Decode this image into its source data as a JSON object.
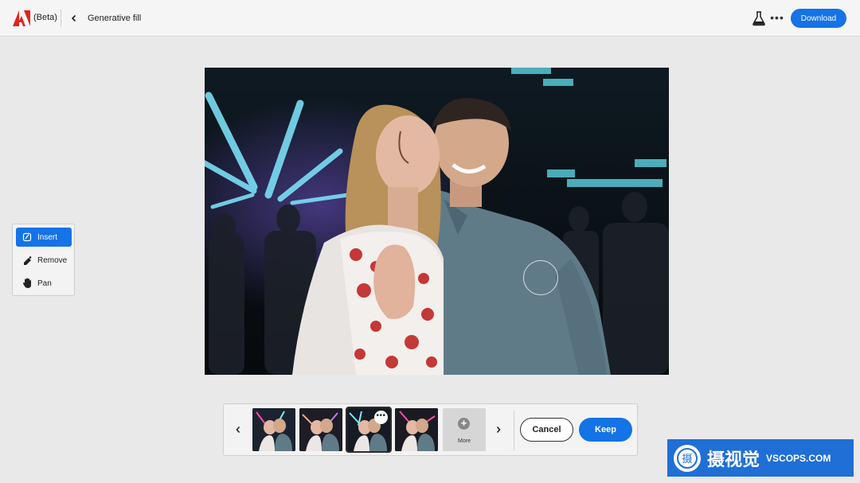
{
  "header": {
    "logo_icon": "adobe-logo-icon",
    "beta_label": "(Beta)",
    "back_icon": "chevron-left-icon",
    "title": "Generative fill",
    "labs_icon": "flask-icon",
    "more_icon": "more-horizontal-icon",
    "more_label": "•••",
    "download_label": "Download",
    "accent_color": "#1473e6"
  },
  "tools": [
    {
      "label": "Insert",
      "icon": "insert-brush-icon",
      "active": true
    },
    {
      "label": "Remove",
      "icon": "eraser-icon",
      "active": false
    },
    {
      "label": "Pan",
      "icon": "hand-icon",
      "active": false
    }
  ],
  "canvas": {
    "image": "photo of a laughing couple at a nightclub with neon lights",
    "cursor": "brush-cursor-circle"
  },
  "variations": {
    "prev_icon": "chevron-left-icon",
    "next_icon": "chevron-right-icon",
    "thumbnails": [
      {
        "selected": false
      },
      {
        "selected": false
      },
      {
        "selected": true,
        "menu_label": "•••"
      },
      {
        "selected": false
      }
    ],
    "more_icon": "plus-circle-icon",
    "more_plus": "+",
    "more_label": "More",
    "cancel_label": "Cancel",
    "keep_label": "Keep"
  },
  "watermark": {
    "cn_text": "摄视觉",
    "en_text": "VSCOPS.COM",
    "logo_char": "摄"
  }
}
